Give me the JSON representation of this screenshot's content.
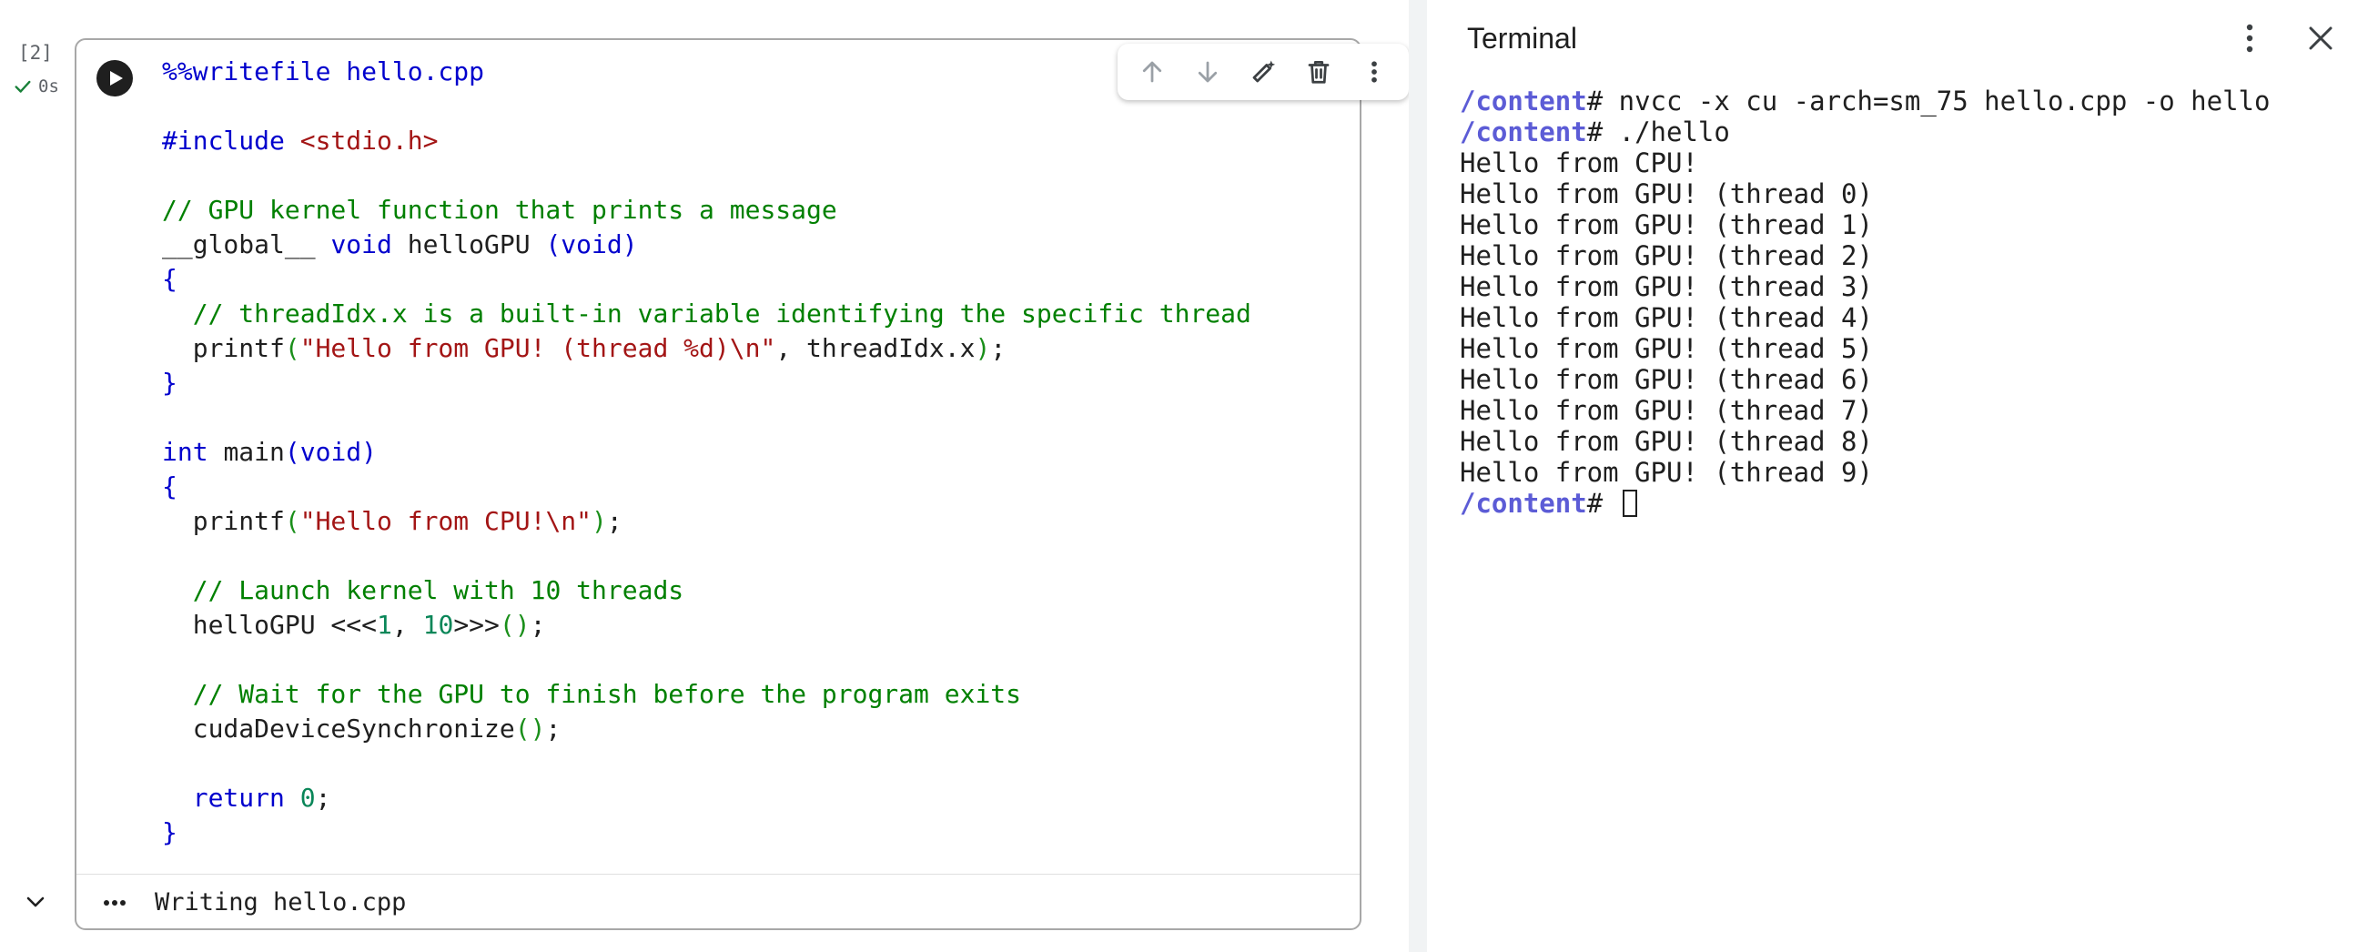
{
  "cell": {
    "execution_count": "[2]",
    "status_time": "0s",
    "output_text": "Writing hello.cpp",
    "code_lines": [
      [
        {
          "t": "%%writefile hello.cpp",
          "c": "kw"
        }
      ],
      [],
      [
        {
          "t": "#include ",
          "c": "kw"
        },
        {
          "t": "<stdio.h>",
          "c": "st"
        }
      ],
      [],
      [
        {
          "t": "// GPU kernel function that prints a message",
          "c": "cm"
        }
      ],
      [
        {
          "t": "__global__ ",
          "c": ""
        },
        {
          "t": "void ",
          "c": "kw"
        },
        {
          "t": "helloGPU ",
          "c": ""
        },
        {
          "t": "(void)",
          "c": "br"
        }
      ],
      [
        {
          "t": "{",
          "c": "br"
        }
      ],
      [
        {
          "t": "  ",
          "c": ""
        },
        {
          "t": "// threadIdx.x is a built-in variable identifying the specific thread",
          "c": "cm"
        }
      ],
      [
        {
          "t": "  printf",
          "c": ""
        },
        {
          "t": "(",
          "c": "pa"
        },
        {
          "t": "\"Hello from GPU! (thread %d)\\n\"",
          "c": "st"
        },
        {
          "t": ", threadIdx.x",
          "c": ""
        },
        {
          "t": ")",
          "c": "pa"
        },
        {
          "t": ";",
          "c": ""
        }
      ],
      [
        {
          "t": "}",
          "c": "br"
        }
      ],
      [],
      [
        {
          "t": "int ",
          "c": "kw"
        },
        {
          "t": "main",
          "c": ""
        },
        {
          "t": "(void)",
          "c": "br"
        }
      ],
      [
        {
          "t": "{",
          "c": "br"
        }
      ],
      [
        {
          "t": "  printf",
          "c": ""
        },
        {
          "t": "(",
          "c": "pa"
        },
        {
          "t": "\"Hello from CPU!\\n\"",
          "c": "st"
        },
        {
          "t": ")",
          "c": "pa"
        },
        {
          "t": ";",
          "c": ""
        }
      ],
      [],
      [
        {
          "t": "  ",
          "c": ""
        },
        {
          "t": "// Launch kernel with 10 threads",
          "c": "cm"
        }
      ],
      [
        {
          "t": "  helloGPU <<<",
          "c": ""
        },
        {
          "t": "1",
          "c": "nu"
        },
        {
          "t": ", ",
          "c": ""
        },
        {
          "t": "10",
          "c": "nu"
        },
        {
          "t": ">>>",
          "c": ""
        },
        {
          "t": "()",
          "c": "pa"
        },
        {
          "t": ";",
          "c": ""
        }
      ],
      [],
      [
        {
          "t": "  ",
          "c": ""
        },
        {
          "t": "// Wait for the GPU to finish before the program exits",
          "c": "cm"
        }
      ],
      [
        {
          "t": "  cudaDeviceSynchronize",
          "c": ""
        },
        {
          "t": "()",
          "c": "pa"
        },
        {
          "t": ";",
          "c": ""
        }
      ],
      [],
      [
        {
          "t": "  ",
          "c": ""
        },
        {
          "t": "return ",
          "c": "kw"
        },
        {
          "t": "0",
          "c": "nu"
        },
        {
          "t": ";",
          "c": ""
        }
      ],
      [
        {
          "t": "}",
          "c": "br"
        }
      ]
    ]
  },
  "toolbar": {
    "buttons": [
      "move-up",
      "move-down",
      "edit",
      "delete",
      "more"
    ]
  },
  "terminal": {
    "title": "Terminal",
    "prompt_path": "/content",
    "prompt_symbol": "# ",
    "lines": [
      {
        "prompt": true,
        "text": "nvcc -x cu -arch=sm_75 hello.cpp -o hello"
      },
      {
        "prompt": true,
        "text": "./hello"
      },
      {
        "prompt": false,
        "text": "Hello from CPU!"
      },
      {
        "prompt": false,
        "text": "Hello from GPU! (thread 0)"
      },
      {
        "prompt": false,
        "text": "Hello from GPU! (thread 1)"
      },
      {
        "prompt": false,
        "text": "Hello from GPU! (thread 2)"
      },
      {
        "prompt": false,
        "text": "Hello from GPU! (thread 3)"
      },
      {
        "prompt": false,
        "text": "Hello from GPU! (thread 4)"
      },
      {
        "prompt": false,
        "text": "Hello from GPU! (thread 5)"
      },
      {
        "prompt": false,
        "text": "Hello from GPU! (thread 6)"
      },
      {
        "prompt": false,
        "text": "Hello from GPU! (thread 7)"
      },
      {
        "prompt": false,
        "text": "Hello from GPU! (thread 8)"
      },
      {
        "prompt": false,
        "text": "Hello from GPU! (thread 9)"
      },
      {
        "prompt": true,
        "text": "",
        "cursor": true
      }
    ]
  },
  "colors": {
    "keyword": "#0000cd",
    "comment": "#008000",
    "string": "#a31515",
    "number": "#098658",
    "prompt_path": "#5c5cd6"
  }
}
